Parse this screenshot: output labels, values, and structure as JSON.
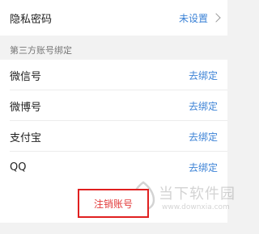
{
  "privacy": {
    "label": "隐私密码",
    "value": "未设置"
  },
  "third_party": {
    "header": "第三方账号绑定",
    "items": [
      {
        "label": "微信号",
        "action": "去绑定"
      },
      {
        "label": "微博号",
        "action": "去绑定"
      },
      {
        "label": "支付宝",
        "action": "去绑定"
      },
      {
        "label": "QQ",
        "action": "去绑定"
      }
    ]
  },
  "logout_label": "注销账号",
  "watermark": {
    "title": "当下软件园",
    "url": "www.downxia.com"
  },
  "colors": {
    "link": "#3b82d6",
    "highlight_border": "#e02020",
    "background": "#f2f2f2"
  }
}
